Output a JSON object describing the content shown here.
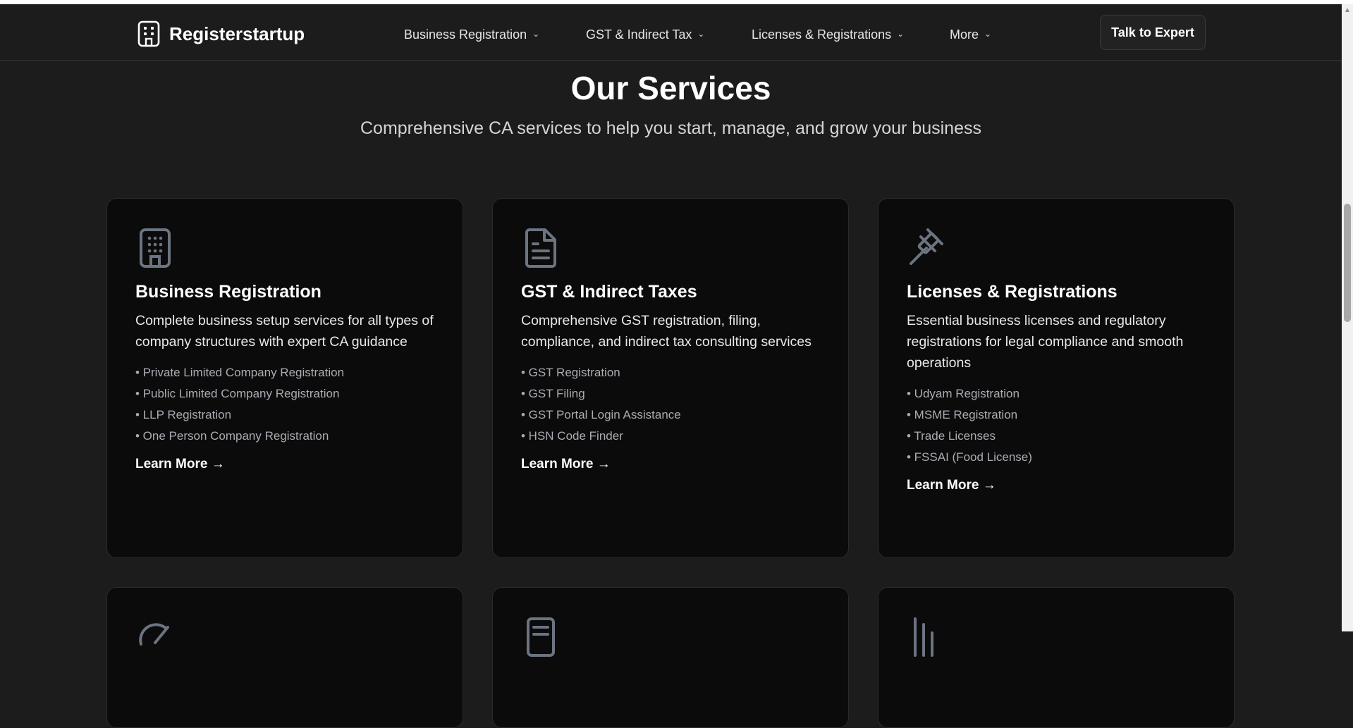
{
  "brand": {
    "name": "Registerstartup",
    "icon": "building-icon"
  },
  "nav": {
    "items": [
      {
        "label": "Business Registration"
      },
      {
        "label": "GST & Indirect Tax"
      },
      {
        "label": "Licenses & Registrations"
      },
      {
        "label": "More"
      }
    ],
    "chevron": "⌄",
    "cta": "Talk to Expert"
  },
  "section": {
    "title": "Our Services",
    "subtitle": "Comprehensive CA services to help you start, manage, and grow your business"
  },
  "cards": [
    {
      "icon": "building-icon",
      "title": "Business Registration",
      "description": "Complete business setup services for all types of company structures with expert CA guidance",
      "items": [
        "• Private Limited Company Registration",
        "• Public Limited Company Registration",
        "• LLP Registration",
        "• One Person Company Registration"
      ],
      "link": "Learn More →"
    },
    {
      "icon": "document-icon",
      "title": "GST & Indirect Taxes",
      "description": "Comprehensive GST registration, filing, compliance, and indirect tax consulting services",
      "items": [
        "• GST Registration",
        "• GST Filing",
        "• GST Portal Login Assistance",
        "• HSN Code Finder"
      ],
      "link": "Learn More →"
    },
    {
      "icon": "gavel-icon",
      "title": "Licenses & Registrations",
      "description": "Essential business licenses and regulatory registrations for legal compliance and smooth operations",
      "items": [
        "• Udyam Registration",
        "• MSME Registration",
        "• Trade Licenses",
        "• FSSAI (Food License)"
      ],
      "link": "Learn More →"
    }
  ],
  "lower_cards": [
    {
      "icon": "gauge-icon"
    },
    {
      "icon": "receipt-icon"
    },
    {
      "icon": "chart-icon"
    }
  ],
  "colors": {
    "background": "#1c1c1c",
    "card": "#0b0b0b",
    "icon": "#6b7480",
    "list_text": "#a9adb3"
  }
}
